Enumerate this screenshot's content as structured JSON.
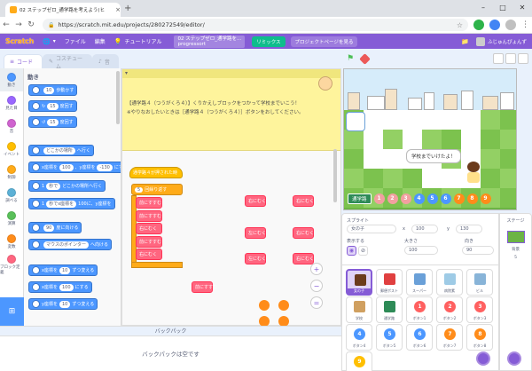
{
  "browser": {
    "tab_title": "02 ステップゼロ_通学路を考えよう(ヒ",
    "url": "https://scratch.mit.edu/projects/280272549/editor/",
    "new_tab": "+",
    "close": "×"
  },
  "menubar": {
    "logo": "Scratch",
    "file": "ファイル",
    "edit": "編集",
    "tutorials": "チュートリアル",
    "project_title": "02 ステップゼロ_通学路を...",
    "project_author": "progressort",
    "remix": "リミックス",
    "project_page": "プロジェクトページを見る",
    "username": "ふじゅんぴょんず"
  },
  "editor_tabs": {
    "code": "コード",
    "costumes": "コスチューム",
    "sounds": "音"
  },
  "categories": [
    {
      "label": "動き",
      "color": "#4c97ff"
    },
    {
      "label": "見た目",
      "color": "#9966ff"
    },
    {
      "label": "音",
      "color": "#cf63cf"
    },
    {
      "label": "イベント",
      "color": "#ffbf00"
    },
    {
      "label": "制御",
      "color": "#ffab19"
    },
    {
      "label": "調べる",
      "color": "#5cb1d6"
    },
    {
      "label": "演算",
      "color": "#59c059"
    },
    {
      "label": "変数",
      "color": "#ff8c1a"
    },
    {
      "label": "ブロック定義",
      "color": "#ff6680"
    }
  ],
  "palette": {
    "heading": "動き",
    "blocks": [
      {
        "pre": "",
        "val": "10",
        "post": "歩動かす"
      },
      {
        "pre": "↻",
        "val": "15",
        "post": "度回す"
      },
      {
        "pre": "↺",
        "val": "15",
        "post": "度回す"
      },
      {
        "pre": "",
        "val": "どこかの場所",
        "post": "へ行く"
      },
      {
        "pre": "x座標を",
        "val": "100",
        "post": "、y座標を",
        "val2": "-130",
        "post2": "にする"
      },
      {
        "pre": "1",
        "val": "秒で",
        "post": "どこかの場所",
        "post2": "へ行く"
      },
      {
        "pre": "1",
        "val": "秒でx座標を",
        "post": "100",
        "post2": "に、y座標を"
      },
      {
        "pre": "",
        "val": "90",
        "post": "度に向ける"
      },
      {
        "pre": "",
        "val": "マウスのポインター",
        "post": "へ向ける"
      },
      {
        "pre": "x座標を",
        "val": "10",
        "post": "ずつ変える"
      },
      {
        "pre": "x座標を",
        "val": "100",
        "post": "にする"
      },
      {
        "pre": "y座標を",
        "val": "10",
        "post": "ずつ変える"
      }
    ]
  },
  "note": {
    "line1": "【通学路４（つうがくろ４）】くりかえしブロックをつかって学校までいこう！",
    "line2": "※やりなおしたいときは［通学路４（つうがくろ４）］ボタンをおしてください。"
  },
  "script": {
    "hat": "通学路４が押された時",
    "repeat_count": "5",
    "repeat_label": "回繰り返す",
    "body": [
      "前にすすむ",
      "前にすすむ",
      "右にむく",
      "前にすすむ",
      "右にむく"
    ],
    "floating": [
      "右にむく",
      "右にむく",
      "左にむく",
      "右にむく",
      "左にむく",
      "右にむく",
      "前にすすむ"
    ]
  },
  "backpack": {
    "header": "バックパック",
    "empty": "バックパックは空です"
  },
  "stage": {
    "speech": "学校までいけたよ！",
    "route_label": "通学路",
    "route_numbers": [
      "1",
      "2",
      "3",
      "4",
      "5",
      "6",
      "7",
      "8",
      "9"
    ],
    "route_colors": [
      "#f2a0a0",
      "#f2a0a0",
      "#f2a0a0",
      "#4c97ff",
      "#4c97ff",
      "#4c97ff",
      "#ff8c1a",
      "#ff8c1a",
      "#ff8c1a"
    ]
  },
  "sprite_info": {
    "sprite_label": "スプライト",
    "sprite_name": "女の子",
    "x_label": "x",
    "x_value": "100",
    "y_label": "y",
    "y_value": "130",
    "show_label": "表示する",
    "size_label": "大きさ",
    "size_value": "100",
    "direction_label": "向き",
    "direction_value": "90"
  },
  "sprites": [
    {
      "name": "女の子",
      "glyph": "",
      "color": "#6b3b1c",
      "shape": "sq"
    },
    {
      "name": "郵便ポスト",
      "glyph": "",
      "color": "#e04040",
      "shape": "sq"
    },
    {
      "name": "スーパー",
      "glyph": "",
      "color": "#6aa0d8",
      "shape": "sq"
    },
    {
      "name": "病院素",
      "glyph": "",
      "color": "#9ecbe6",
      "shape": "sq"
    },
    {
      "name": "ビル",
      "glyph": "",
      "color": "#88b4d8",
      "shape": "sq"
    },
    {
      "name": "学校",
      "glyph": "",
      "color": "#d0a060",
      "shape": "sq"
    },
    {
      "name": "通学路",
      "glyph": "",
      "color": "#2e8b57",
      "shape": "sq"
    },
    {
      "name": "ボタン1",
      "glyph": "1",
      "color": "#ff6060",
      "shape": "c"
    },
    {
      "name": "ボタン2",
      "glyph": "2",
      "color": "#ff6060",
      "shape": "c"
    },
    {
      "name": "ボタン3",
      "glyph": "3",
      "color": "#ff6060",
      "shape": "c"
    },
    {
      "name": "ボタン4",
      "glyph": "4",
      "color": "#4c97ff",
      "shape": "c"
    },
    {
      "name": "ボタン5",
      "glyph": "5",
      "color": "#4c97ff",
      "shape": "c"
    },
    {
      "name": "ボタン6",
      "glyph": "6",
      "color": "#4c97ff",
      "shape": "c"
    },
    {
      "name": "ボタン7",
      "glyph": "7",
      "color": "#ff8c1a",
      "shape": "c"
    },
    {
      "name": "ボタン8",
      "glyph": "8",
      "color": "#ff8c1a",
      "shape": "c"
    },
    {
      "name": "ボタン9",
      "glyph": "9",
      "color": "#ffbf00",
      "shape": "c"
    }
  ],
  "stage_panel": {
    "label": "ステージ",
    "backdrops_label": "背景",
    "backdrops_count": "5"
  }
}
